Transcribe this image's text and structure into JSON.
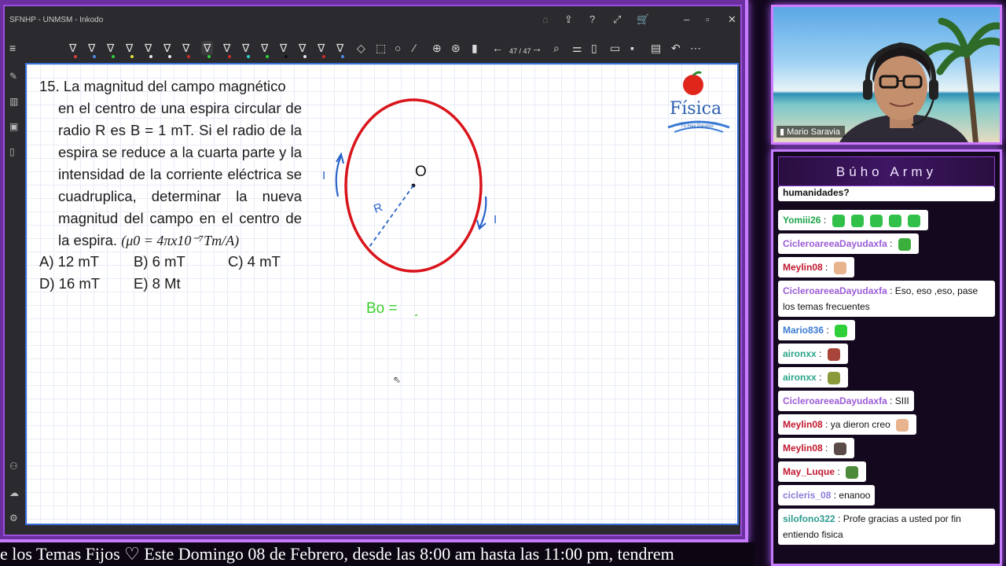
{
  "window": {
    "title": "SFNHP - UNMSM - Inkodo",
    "page_counter": "47 / 47"
  },
  "problem": {
    "line1": "15. La magnitud del campo magnético",
    "body": "en el centro de una espira circular de radio R es B = 1 mT. Si el radio de la espira se reduce a la cuarta parte y la intensidad de la corriente eléctrica se cuadruplica, determinar la nueva magnitud del campo en el centro de la espira.",
    "formula": "(μ0 = 4πx10⁻⁷Tm/A)",
    "options": {
      "a": "A) 12 mT",
      "b": "B) 6 mT",
      "c": "C) 4 mT",
      "d": "D) 16 mT",
      "e": "E) 8 Mt"
    }
  },
  "logo": {
    "text": "Física",
    "tagline": "Tú Hay Paraíso"
  },
  "annotations": {
    "current_left": "I",
    "current_right": "I",
    "center": "O",
    "radius": "R",
    "b0": "Bo ="
  },
  "ticker": {
    "text": "e los Temas Fijos ♡  Este Domingo 08 de Febrero, desde las 8:00 am hasta las 11:00 pm, tendrem"
  },
  "webcam": {
    "name": "Mario Saravia"
  },
  "chat": {
    "header": "Búho Army",
    "messages": [
      {
        "user": "",
        "text": "humanidades?"
      },
      {
        "user": "Yomiii26",
        "text": ":"
      },
      {
        "user": "CicleroareeaDayudaxfa",
        "text": ":"
      },
      {
        "user": "Meylin08",
        "text": ":"
      },
      {
        "user": "CicleroareeaDayudaxfa",
        "text": ": Eso, eso ,eso, pase los temas frecuentes"
      },
      {
        "user": "Mario836",
        "text": ":"
      },
      {
        "user": "aironxx",
        "text": ":"
      },
      {
        "user": "aironxx",
        "text": ":"
      },
      {
        "user": "CicleroareeaDayudaxfa",
        "text": ": SIII"
      },
      {
        "user": "Meylin08",
        "text": ": ya dieron creo"
      },
      {
        "user": "Meylin08",
        "text": ":"
      },
      {
        "user": "May_Luque",
        "text": ":"
      },
      {
        "user": "cicleris_08",
        "text": ": enanoo"
      },
      {
        "user": "silofono322",
        "text": ": Profe gracias a usted por fin entiendo fisica"
      }
    ],
    "user_colors": {
      "Yomiii26": "#1fa34a",
      "CicleroareeaDayudaxfa": "#9b5cd6",
      "Meylin08": "#c0182f",
      "Mario836": "#3c7bd1",
      "aironxx": "#2aa58a",
      "May_Luque": "#c0182f",
      "cicleris_08": "#8e7bd8",
      "silofono322": "#2b9a8e"
    }
  },
  "colors": {
    "accent": "#c77cff",
    "circle": "#d9141b",
    "ink_blue": "#2a62c9",
    "ink_green": "#3bcf2c"
  }
}
